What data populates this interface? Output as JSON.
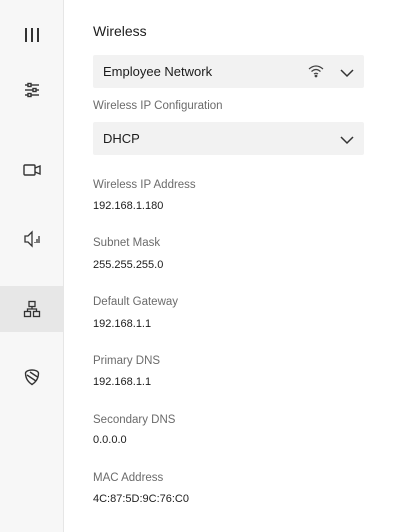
{
  "icons": {
    "menu": "hamburger-vertical-bars",
    "sliders": "sliders-icon",
    "camera": "video-camera-icon",
    "audio": "speaker-signal-icon",
    "network": "network-topology-icon",
    "shield": "shield-icon",
    "wifi": "wifi-icon",
    "chevron": "chevron-down-icon"
  },
  "wireless": {
    "title": "Wireless",
    "network_selected": "Employee Network",
    "ip_config_label": "Wireless IP Configuration",
    "ip_config_selected": "DHCP"
  },
  "fields": [
    {
      "label": "Wireless IP Address",
      "value": "192.168.1.180"
    },
    {
      "label": "Subnet Mask",
      "value": "255.255.255.0"
    },
    {
      "label": "Default Gateway",
      "value": "192.168.1.1"
    },
    {
      "label": "Primary DNS",
      "value": "192.168.1.1"
    },
    {
      "label": "Secondary DNS",
      "value": "0.0.0.0"
    },
    {
      "label": "MAC Address",
      "value": "4C:87:5D:9C:76:C0"
    }
  ]
}
